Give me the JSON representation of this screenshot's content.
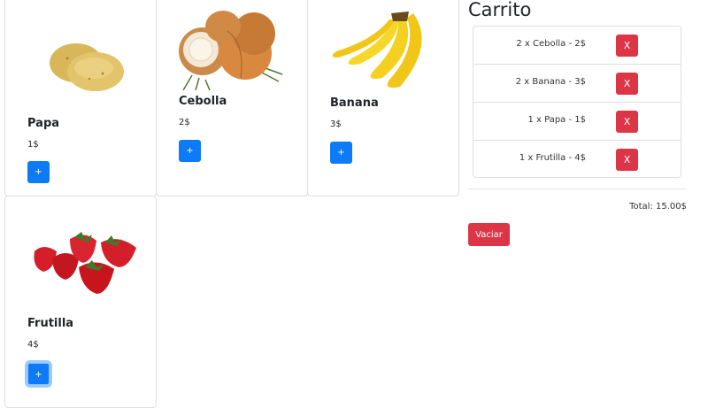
{
  "products": [
    {
      "name": "Papa",
      "price": "1$",
      "add_label": "+",
      "image": "potato-image"
    },
    {
      "name": "Cebolla",
      "price": "2$",
      "add_label": "+",
      "image": "onion-image"
    },
    {
      "name": "Banana",
      "price": "3$",
      "add_label": "+",
      "image": "banana-image"
    },
    {
      "name": "Frutilla",
      "price": "4$",
      "add_label": "+",
      "image": "strawberry-image"
    }
  ],
  "cart": {
    "title": "Carrito",
    "items": [
      {
        "text": "2 x Cebolla - 2$",
        "remove_label": "X"
      },
      {
        "text": "2 x Banana - 3$",
        "remove_label": "X"
      },
      {
        "text": "1 x Papa - 1$",
        "remove_label": "X"
      },
      {
        "text": "1 x Frutilla - 4$",
        "remove_label": "X"
      }
    ],
    "total": "Total: 15.00$",
    "empty_label": "Vaciar"
  },
  "colors": {
    "primary": "#0d7bf5",
    "danger": "#dc3545"
  }
}
